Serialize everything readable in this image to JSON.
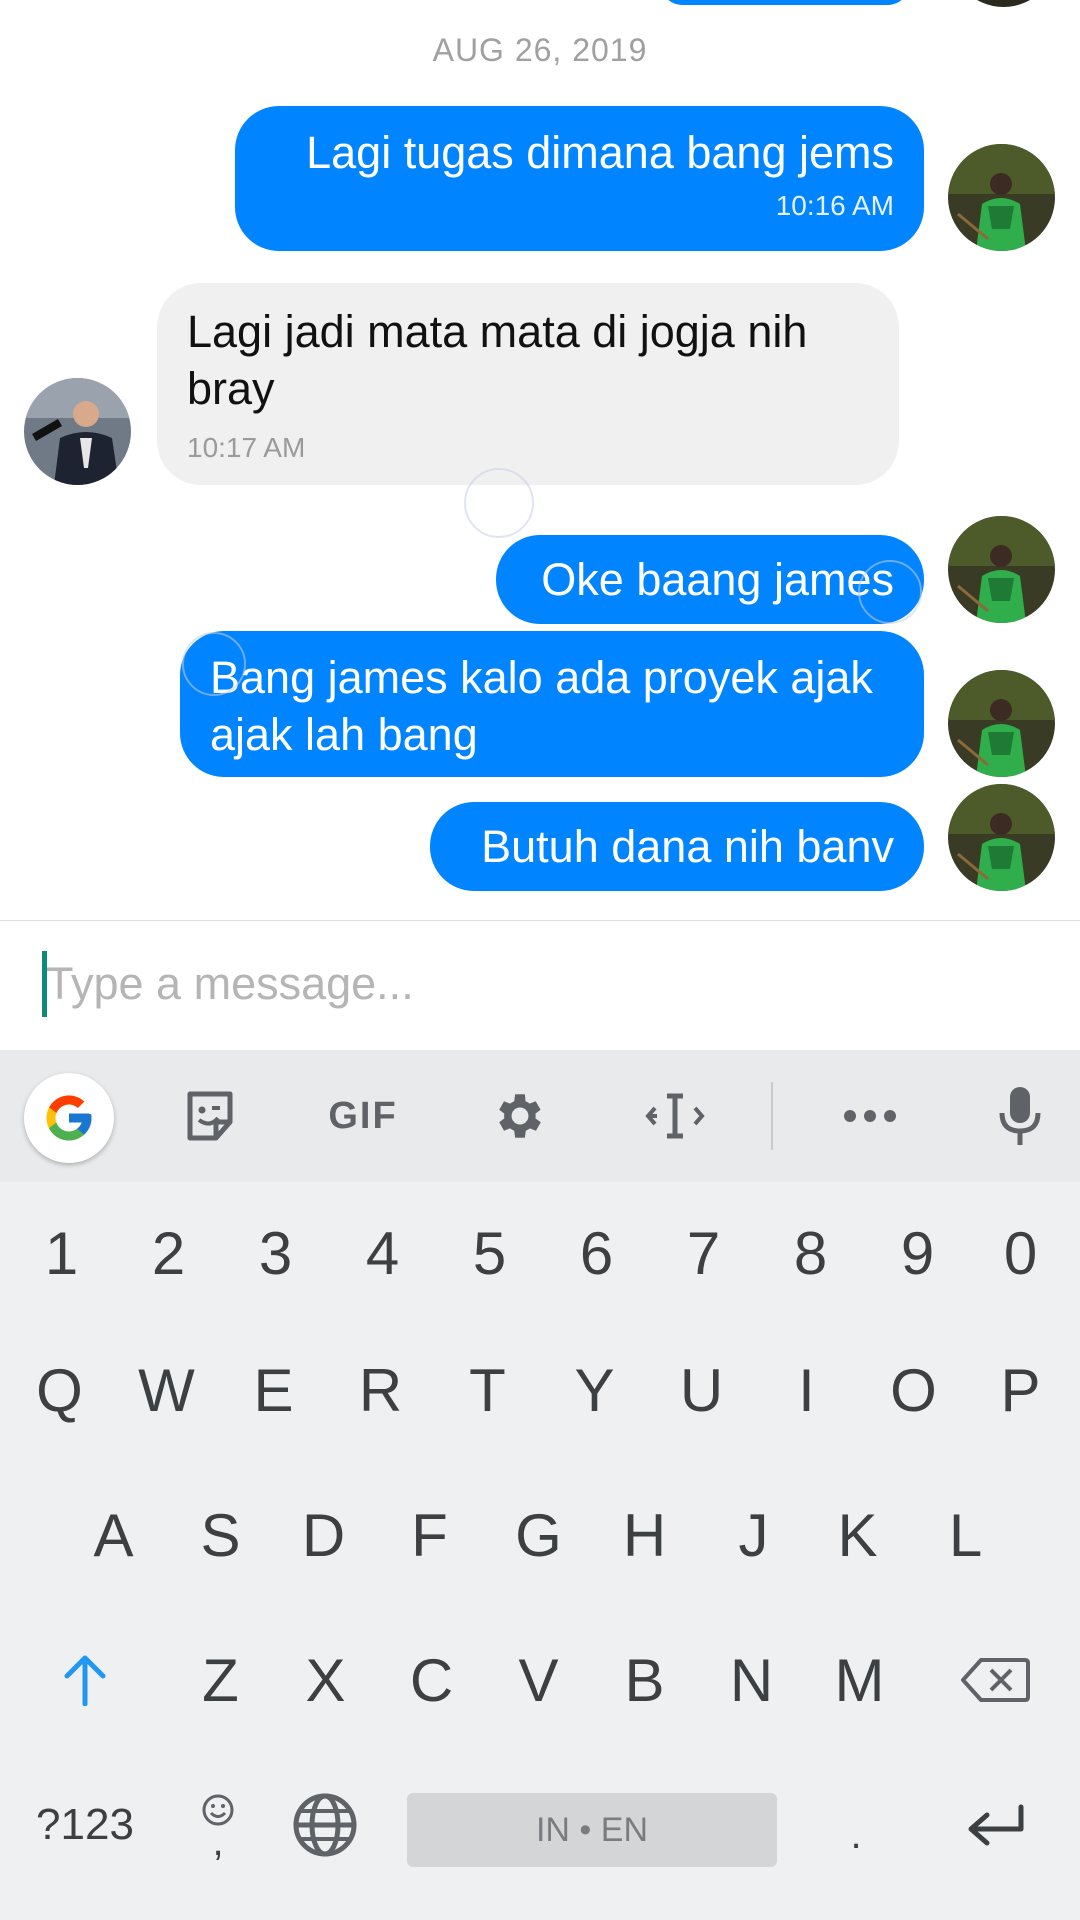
{
  "chat": {
    "date_separator": "AUG 26, 2019",
    "messages": [
      {
        "text": "Lagi tugas dimana bang jems",
        "time": "10:16 AM"
      },
      {
        "text": "Lagi jadi mata mata di jogja nih bray",
        "time": "10:17 AM"
      },
      {
        "text": "Oke baang james"
      },
      {
        "text": "Bang james kalo ada proyek ajak ajak lah bang"
      },
      {
        "text": "Butuh dana nih banv"
      }
    ]
  },
  "composer": {
    "placeholder": "Type a message...",
    "value": ""
  },
  "keyboard": {
    "toolbar": [
      "google-icon",
      "sticker-icon",
      "gif",
      "settings-icon",
      "cursor-control-icon",
      "more-icon",
      "mic-icon"
    ],
    "gif_label": "GIF",
    "number_row": [
      "1",
      "2",
      "3",
      "4",
      "5",
      "6",
      "7",
      "8",
      "9",
      "0"
    ],
    "row1": [
      "Q",
      "W",
      "E",
      "R",
      "T",
      "Y",
      "U",
      "I",
      "O",
      "P"
    ],
    "row2": [
      "A",
      "S",
      "D",
      "F",
      "G",
      "H",
      "J",
      "K",
      "L"
    ],
    "row3": [
      "Z",
      "X",
      "C",
      "V",
      "B",
      "N",
      "M"
    ],
    "symbols_label": "?123",
    "comma_label": ",",
    "period_label": ".",
    "space_label": "IN • EN",
    "colors": {
      "accent": "#0084ff",
      "shift": "#2196f3",
      "cursor": "#0f8a7a"
    }
  }
}
